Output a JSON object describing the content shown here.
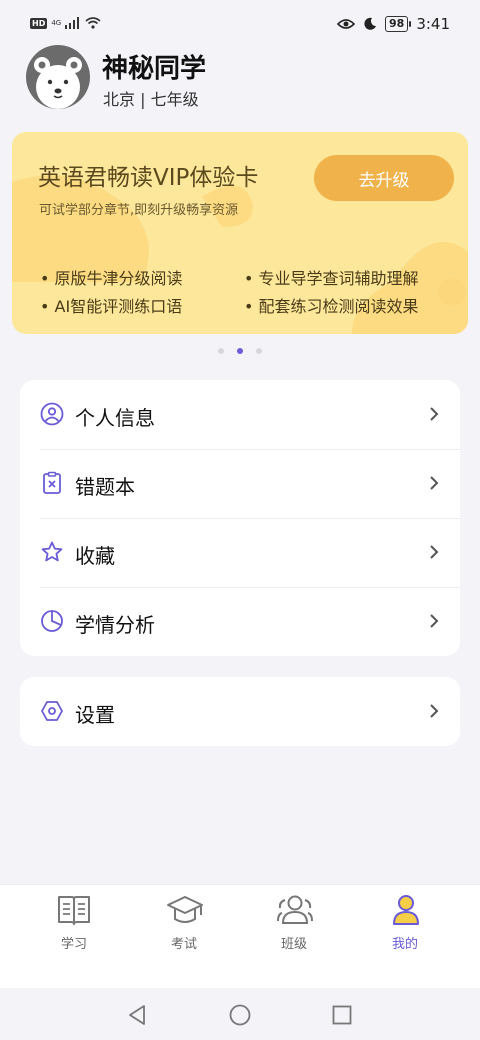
{
  "status_bar": {
    "hd": "HD",
    "network": "4G",
    "battery": "98",
    "time": "3:41"
  },
  "profile": {
    "name": "神秘同学",
    "location_grade": "北京 | 七年级"
  },
  "banner": {
    "title": "英语君畅读VIP体验卡",
    "description": "可试学部分章节,即刻升级畅享资源",
    "upgrade_label": "去升级",
    "features": [
      "• 原版牛津分级阅读",
      "• 专业导学查词辅助理解",
      "• AI智能评测练口语",
      "• 配套练习检测阅读效果"
    ],
    "colors": {
      "background": "#fde79a",
      "button": "#f0b24a"
    }
  },
  "carousel": {
    "active_index": 1,
    "count": 3
  },
  "menu": {
    "items": [
      {
        "label": "个人信息",
        "icon": "user-circle-icon"
      },
      {
        "label": "错题本",
        "icon": "clipboard-x-icon"
      },
      {
        "label": "收藏",
        "icon": "star-icon"
      },
      {
        "label": "学情分析",
        "icon": "pie-chart-icon"
      }
    ],
    "settings": {
      "label": "设置",
      "icon": "settings-hexagon-icon"
    }
  },
  "bottom_nav": {
    "items": [
      {
        "label": "学习",
        "icon": "book-icon"
      },
      {
        "label": "考试",
        "icon": "graduation-cap-icon"
      },
      {
        "label": "班级",
        "icon": "group-icon"
      },
      {
        "label": "我的",
        "icon": "person-icon",
        "active": true
      }
    ]
  },
  "accent_color": "#6a5bd6"
}
